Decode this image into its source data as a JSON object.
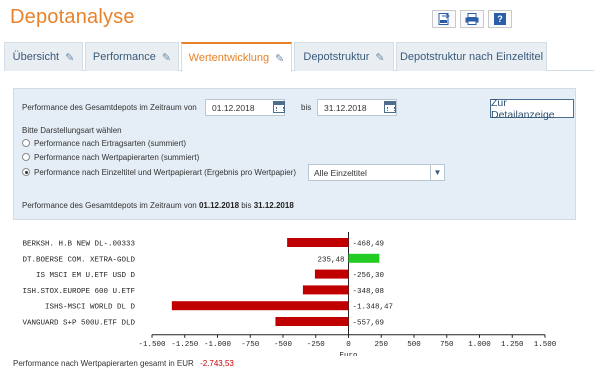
{
  "header": {
    "title": "Depotanalyse",
    "toolbar": {
      "csv_icon": "csv-export-icon",
      "print_icon": "print-icon",
      "help_label": "?"
    }
  },
  "tabs": [
    {
      "label": "Übersicht",
      "active": false
    },
    {
      "label": "Performance",
      "active": false
    },
    {
      "label": "Wertentwicklung",
      "active": true
    },
    {
      "label": "Depotstruktur",
      "active": false
    },
    {
      "label": "Depotstruktur nach Einzeltitel",
      "active": false
    }
  ],
  "filter": {
    "range_label": "Performance des Gesamtdepots im Zeitraum von",
    "from_date": "01.12.2018",
    "to_label": "bis",
    "to_date": "31.12.2018",
    "detail_button": "Zur Detailanzeige",
    "display_label": "Bitte Darstellungsart wählen",
    "options": [
      {
        "label": "Performance nach Ertragsarten (summiert)",
        "selected": false
      },
      {
        "label": "Performance nach Wertpapierarten (summiert)",
        "selected": false
      },
      {
        "label": "Performance nach Einzeltitel und Wertpapierart (Ergebnis pro Wertpapier)",
        "selected": true
      }
    ],
    "select_value": "Alle Einzeltitel",
    "summary_prefix": "Performance des Gesamtdepots im Zeitraum von",
    "summary_from": "01.12.2018",
    "summary_mid": "bis",
    "summary_to": "31.12.2018"
  },
  "chart_data": {
    "type": "bar",
    "orientation": "horizontal",
    "categories": [
      "BERKSH. H.B NEW DL-.00333",
      "DT.BOERSE COM. XETRA-GOLD",
      "IS MSCI EM U.ETF USD D",
      "ISH.STOX.EUROPE 600 U.ETF",
      "ISHS-MSCI WORLD DL D",
      "VANGUARD S+P 500U.ETF DLD"
    ],
    "values": [
      -468.49,
      235.48,
      -256.3,
      -348.08,
      -1348.47,
      -557.69
    ],
    "value_labels": [
      "-468,49",
      "235,48",
      "-256,30",
      "-348,08",
      "-1.348,47",
      "-557,69"
    ],
    "xlim": [
      -1500,
      1500
    ],
    "xticks": [
      -1500,
      -1250,
      -1000,
      -750,
      -500,
      -250,
      0,
      250,
      500,
      750,
      1000,
      1250,
      1500
    ],
    "xtick_labels": [
      "-1.500",
      "-1.250",
      "-1.000",
      "-750",
      "-500",
      "-250",
      "0",
      "250",
      "500",
      "750",
      "1.000",
      "1.250",
      "1.500"
    ],
    "xlabel": "Euro",
    "colors": {
      "negative": "#c00000",
      "positive": "#22cc22"
    }
  },
  "footer": {
    "label": "Performance nach Wertpapierarten gesamt in EUR",
    "total": "-2.743,53"
  }
}
